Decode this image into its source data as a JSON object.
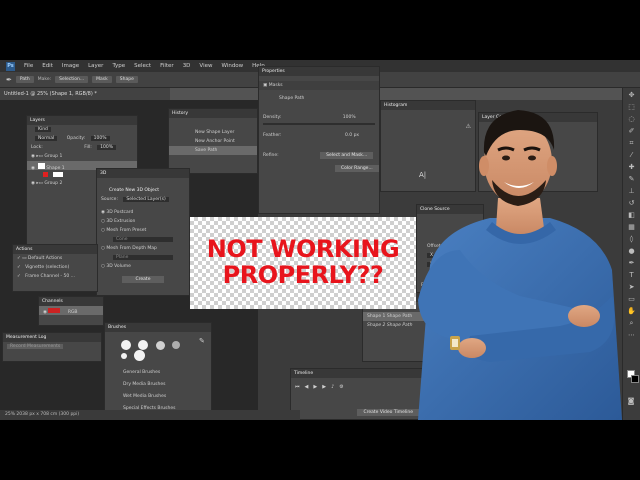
{
  "menu": {
    "logo": "Ps",
    "items": [
      "File",
      "Edit",
      "Image",
      "Layer",
      "Type",
      "Select",
      "Filter",
      "3D",
      "View",
      "Window",
      "Help"
    ]
  },
  "options": {
    "mode": "Path",
    "make_label": "Make:",
    "selection": "Selection...",
    "mask": "Mask",
    "shape": "Shape"
  },
  "document": {
    "tab": "Untitled-1 @ 25% (Shape 1, RGB/8) *"
  },
  "layers": {
    "title": "Layers",
    "kind": "Kind",
    "blend": "Normal",
    "opacity_label": "Opacity:",
    "opacity": "100%",
    "lock_label": "Lock:",
    "fill_label": "Fill:",
    "fill": "100%",
    "rows": [
      "Group 1",
      "Shape 1",
      "Group 2"
    ]
  },
  "history": {
    "title": "History",
    "items": [
      "New Shape Layer",
      "New Anchor Point",
      "Save Path"
    ]
  },
  "properties": {
    "title": "Properties",
    "section": "Masks",
    "item": "Shape Path",
    "density_label": "Density:",
    "density": "100%",
    "feather_label": "Feather:",
    "feather": "0.0 px",
    "refine": "Refine:",
    "select_mask": "Select and Mask...",
    "color_range": "Color Range..."
  },
  "histogram": {
    "title": "Histogram"
  },
  "layer_comps": {
    "title": "Layer Comps"
  },
  "panel_3d": {
    "title": "3D",
    "heading": "Create New 3D Object",
    "source_label": "Source:",
    "source": "Selected Layer(s)",
    "options": [
      "3D Postcard",
      "3D Extrusion",
      "Mesh From Preset",
      "Cone",
      "Mesh From Depth Map",
      "Plane",
      "3D Volume"
    ],
    "create": "Create"
  },
  "actions": {
    "title": "Actions",
    "items": [
      "Default Actions",
      "Vignette (selection)",
      "Frame Channel - 50 ..."
    ]
  },
  "channels": {
    "title": "Channels",
    "item": "RGB"
  },
  "measurement": {
    "title": "Measurement Log",
    "record": "Record Measurements"
  },
  "brushes": {
    "title": "Brushes",
    "groups": [
      "General Brushes",
      "Dry Media Brushes",
      "Wet Media Brushes",
      "Special Effects Brushes"
    ]
  },
  "clone_source": {
    "title": "Clone Source",
    "offset": "Offset:",
    "x": "X: 0 px",
    "y": "Y: 0 px",
    "frame_offset": "Frame Offset:"
  },
  "paths": {
    "title": "Paths",
    "items": [
      "Shape 1 Shape Path",
      "Shape 2 Shape Path"
    ]
  },
  "timeline": {
    "title": "Timeline",
    "create": "Create Video Timeline"
  },
  "status": {
    "text": "25%      2038 px x 708 cm (300 ppi)"
  },
  "headline": {
    "line1": "NOT WORKING",
    "line2": "PROPERLY??",
    "color": "#e8141c"
  },
  "colors": {
    "panel": "#474747",
    "panel_header": "#383838",
    "app_bg": "#535353",
    "canvas": "#282828",
    "shirt": "#3a6fb0"
  }
}
